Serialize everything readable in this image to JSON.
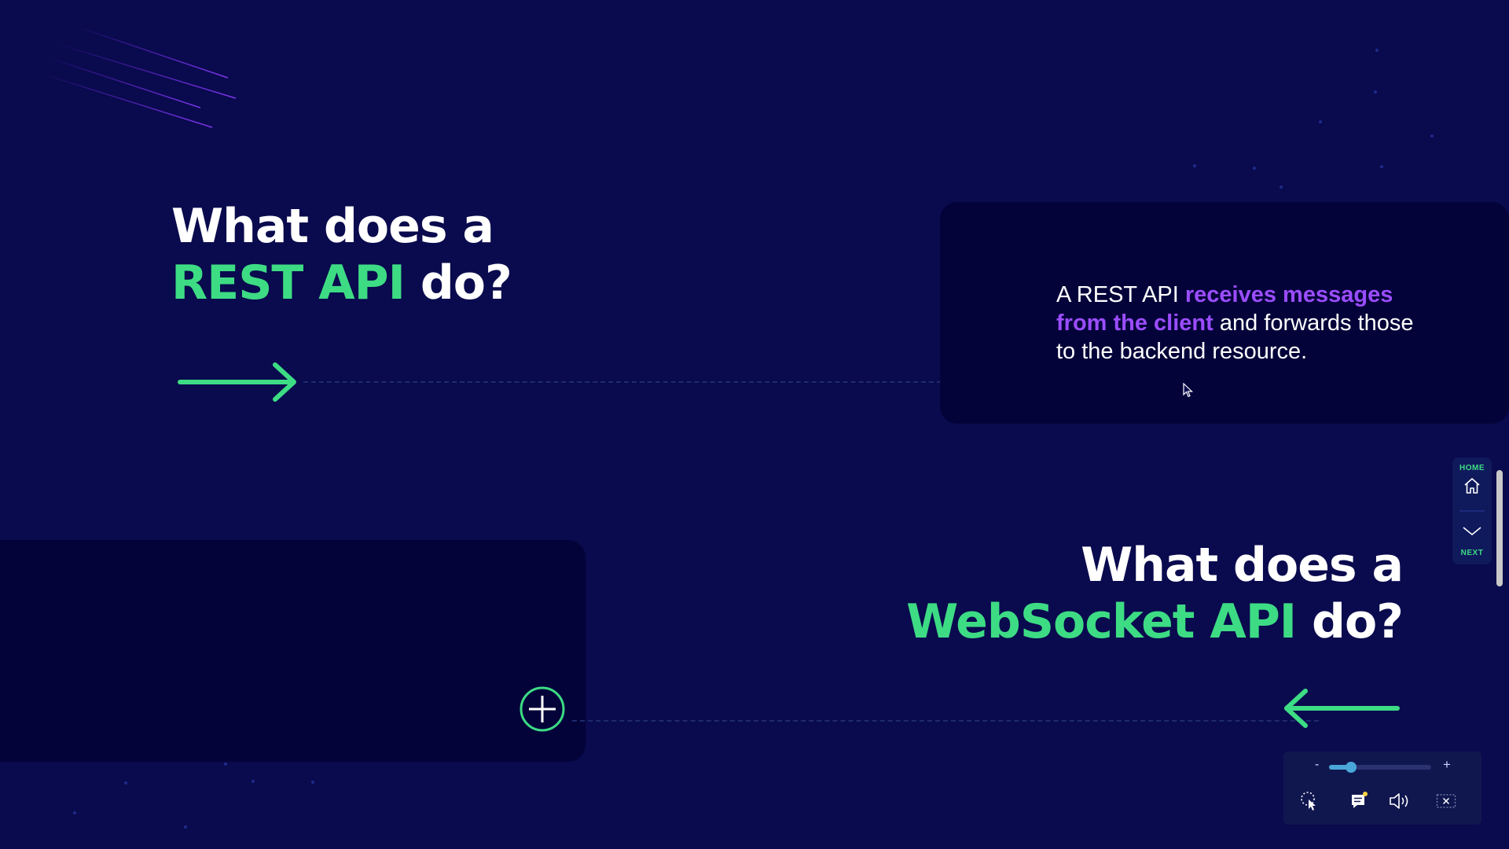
{
  "section1": {
    "heading_line1": "What does a",
    "heading_highlight": "REST API",
    "heading_end": " do?",
    "answer_pre": "A REST API ",
    "answer_highlight": "receives messages from the client",
    "answer_post": " and forwards those to the backend resource."
  },
  "section2": {
    "heading_line1": "What does a",
    "heading_highlight": "WebSocket API",
    "heading_end": " do?"
  },
  "side_nav": {
    "home_label": "HOME",
    "next_label": "NEXT",
    "home_icon": "home-icon",
    "next_icon": "chevron-down-icon"
  },
  "toolbar": {
    "zoom_minus": "-",
    "zoom_plus": "+",
    "zoom_level": 0.2,
    "tools": [
      "cursor-icon",
      "comment-icon",
      "volume-icon",
      "close-icon"
    ]
  },
  "colors": {
    "background": "#0a0a4e",
    "card": "#03033a",
    "accent_green": "#3ddc84",
    "accent_purple": "#9b4dff"
  }
}
